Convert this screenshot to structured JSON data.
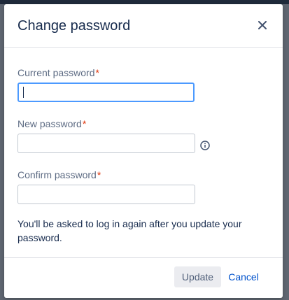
{
  "dialog": {
    "title": "Change password",
    "close_icon": "close-icon"
  },
  "fields": {
    "current": {
      "label": "Current password",
      "required_marker": "*",
      "value": ""
    },
    "new": {
      "label": "New password",
      "required_marker": "*",
      "value": "",
      "info_icon": "info-icon"
    },
    "confirm": {
      "label": "Confirm password",
      "required_marker": "*",
      "value": ""
    }
  },
  "note": "You'll be asked to log in again after you update your password.",
  "footer": {
    "update_label": "Update",
    "cancel_label": "Cancel"
  },
  "colors": {
    "accent": "#0052cc",
    "focus_ring": "#4c9aff",
    "required": "#de350b"
  }
}
